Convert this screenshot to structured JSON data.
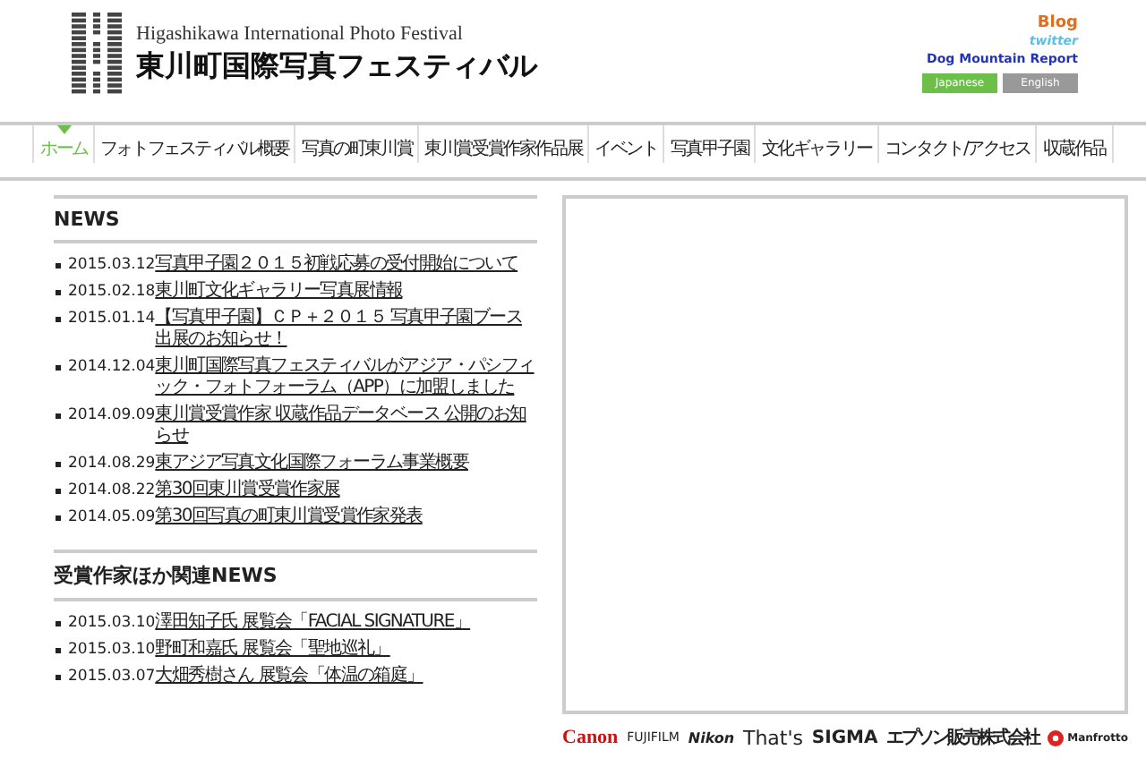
{
  "header": {
    "subtitle": "Higashikawa International Photo Festival",
    "title": "東川町国際写真フェスティバル",
    "links": [
      {
        "label": "Blog",
        "kind": "blog"
      },
      {
        "label": "twitter",
        "kind": "twitter"
      },
      {
        "label": "Dog Mountain Report",
        "kind": "report"
      }
    ],
    "languages": [
      {
        "label": "Japanese",
        "selected": true
      },
      {
        "label": "English",
        "selected": false
      }
    ]
  },
  "nav": [
    {
      "label": "ホーム",
      "selected": true
    },
    {
      "label": "フォトフェスティバル概要",
      "selected": false
    },
    {
      "label": "写真の町東川賞",
      "selected": false
    },
    {
      "label": "東川賞受賞作家作品展",
      "selected": false
    },
    {
      "label": "イベント",
      "selected": false
    },
    {
      "label": "写真甲子園",
      "selected": false
    },
    {
      "label": "文化ギャラリー",
      "selected": false
    },
    {
      "label": "コンタクト/アクセス",
      "selected": false
    },
    {
      "label": "収蔵作品",
      "selected": false
    }
  ],
  "news": {
    "heading": "NEWS",
    "items": [
      {
        "date": "2015.03.12",
        "title": "写真甲子園２０１５初戦応募の受付開始について"
      },
      {
        "date": "2015.02.18",
        "title": "東川町文化ギャラリー写真展情報"
      },
      {
        "date": "2015.01.14",
        "title": "【写真甲子園】ＣＰ＋２０１５ 写真甲子園ブース出展のお知らせ！"
      },
      {
        "date": "2014.12.04",
        "title": "東川町国際写真フェスティバルがアジア・パシフィック・フォトフォーラム（APP）に加盟しました"
      },
      {
        "date": "2014.09.09",
        "title": "東川賞受賞作家 収蔵作品データベース 公開のお知らせ"
      },
      {
        "date": "2014.08.29",
        "title": "東アジア写真文化国際フォーラム事業概要"
      },
      {
        "date": "2014.08.22",
        "title": "第30回東川賞受賞作家展"
      },
      {
        "date": "2014.05.09",
        "title": "第30回写真の町東川賞受賞作家発表"
      }
    ]
  },
  "related_news": {
    "heading": "受賞作家ほか関連NEWS",
    "items": [
      {
        "date": "2015.03.10",
        "title": "澤田知子氏 展覧会「FACIAL SIGNATURE」"
      },
      {
        "date": "2015.03.10",
        "title": "野町和嘉氏 展覧会「聖地巡礼」"
      },
      {
        "date": "2015.03.07",
        "title": "大畑秀樹さん 展覧会「体温の箱庭」"
      }
    ]
  },
  "sponsors": [
    {
      "label": "Canon",
      "kind": "canon"
    },
    {
      "label": "FUJIFILM",
      "kind": "fujifilm"
    },
    {
      "label": "Nikon",
      "kind": "nikon"
    },
    {
      "label": "That's",
      "kind": "thats"
    },
    {
      "label": "SIGMA",
      "kind": "sigma"
    },
    {
      "label": "エプソン販売株式会社",
      "kind": "epson"
    },
    {
      "label": "Manfrotto",
      "kind": "manfrotto"
    }
  ]
}
